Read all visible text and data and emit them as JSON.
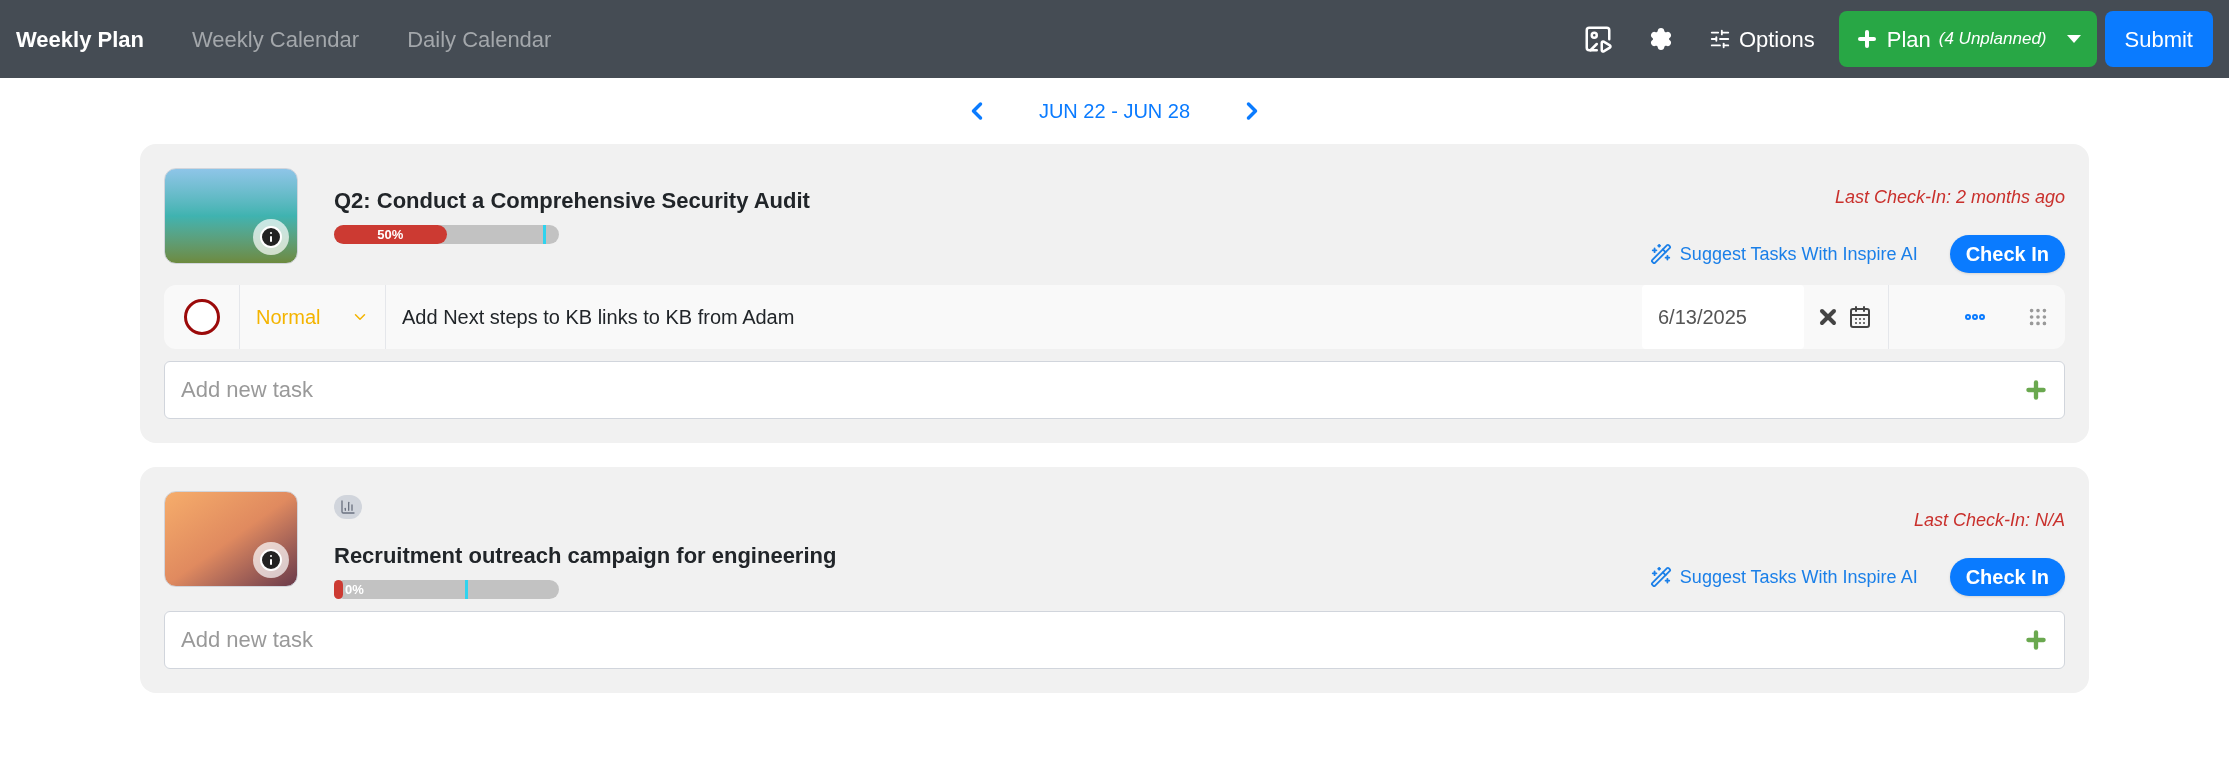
{
  "nav": {
    "brand": "Weekly Plan",
    "links": [
      {
        "label": "Weekly Calendar",
        "selected": false
      },
      {
        "label": "Daily Calendar",
        "selected": false
      }
    ],
    "options_label": "Options",
    "plan_button": {
      "label": "Plan",
      "note": "(4 Unplanned)"
    },
    "submit_label": "Submit"
  },
  "week": {
    "range": "JUN 22 - JUN 28"
  },
  "goals": [
    {
      "kind": "photo",
      "has_metric_badge": false,
      "title": "Q2: Conduct a Comprehensive Security Audit",
      "progress": {
        "level": 0.5,
        "label": "50%",
        "marker": {
          "level": 0.93
        }
      },
      "last_checkin": "Last Check-In: 2 months ago",
      "suggest_label": "Suggest Tasks With Inspire AI",
      "checkin_label": "Check In",
      "tasks": [
        {
          "completed": false,
          "priority": "Normal",
          "text": "Add Next steps to KB links to KB from Adam",
          "date": "6/13/2025"
        }
      ],
      "new_task_placeholder": "Add new task"
    },
    {
      "kind": "gradient",
      "has_metric_badge": true,
      "title": "Recruitment outreach campaign for engineering",
      "progress": {
        "level": 0,
        "label": "0%",
        "marker": {
          "level": 0.58
        }
      },
      "last_checkin": "Last Check-In: N/A",
      "suggest_label": "Suggest Tasks With Inspire AI",
      "checkin_label": "Check In",
      "new_task_placeholder": "Add new task"
    }
  ]
}
